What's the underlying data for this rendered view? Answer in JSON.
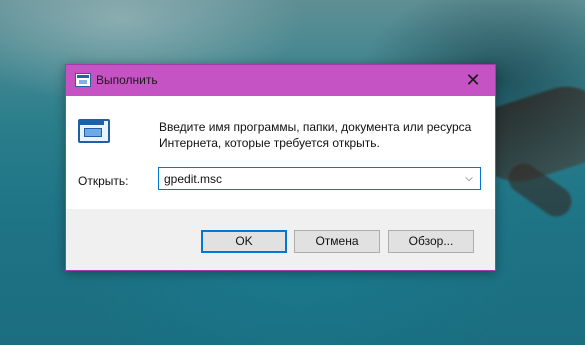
{
  "window": {
    "title": "Выполнить",
    "close_glyph": "✕",
    "icon": "run-icon"
  },
  "content": {
    "app_icon": "run-program-icon",
    "description": "Введите имя программы, папки, документа или ресурса Интернета, которые требуется открыть.",
    "open_label": "Открыть:",
    "command_value": "gpedit.msc",
    "dropdown_glyph": "⌵"
  },
  "buttons": {
    "ok": "OK",
    "cancel": "Отмена",
    "browse": "Обзор..."
  },
  "colors": {
    "titlebar": "#c653c4",
    "focus_border": "#0078d7",
    "footer": "#f0f0f0"
  }
}
